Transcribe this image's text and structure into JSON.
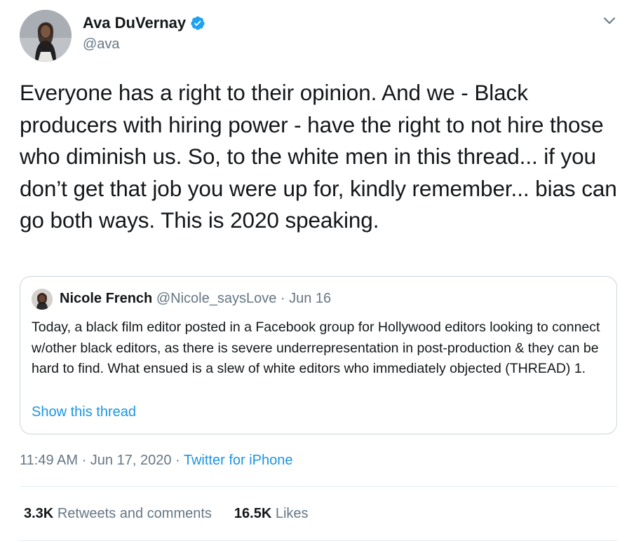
{
  "tweet": {
    "author": {
      "name": "Ava DuVernay",
      "handle": "@ava",
      "verified": true
    },
    "text": "Everyone has a right to their opinion. And we - Black producers with hiring power - have the right to not hire those who diminish us. So, to the white men in this thread... if you don’t get that job you were up for, kindly remember... bias can go both ways. This is 2020 speaking.",
    "quoted": {
      "name": "Nicole French",
      "handle": "@Nicole_saysLove",
      "date_meta": "· Jun 16",
      "text": "Today, a black film editor posted in a Facebook group for Hollywood editors looking to connect w/other black editors, as there is severe underrepresentation in post-production & they can be hard to find.  What ensued is a slew of white editors who immediately objected (THREAD) 1.",
      "show_thread": "Show this thread"
    },
    "timestamp": "11:49 AM · Jun 17, 2020 · ",
    "source": "Twitter for iPhone",
    "stats": {
      "retweets_count": "3.3K",
      "retweets_label": "Retweets and comments",
      "likes_count": "16.5K",
      "likes_label": "Likes"
    }
  },
  "icons": {
    "verified": "verified-badge-icon",
    "menu": "chevron-down-icon"
  },
  "colors": {
    "link": "#1b95e0",
    "secondary_text": "#657786",
    "primary_text": "#14171a",
    "border": "#ccd6dd",
    "verified": "#1da1f2"
  }
}
